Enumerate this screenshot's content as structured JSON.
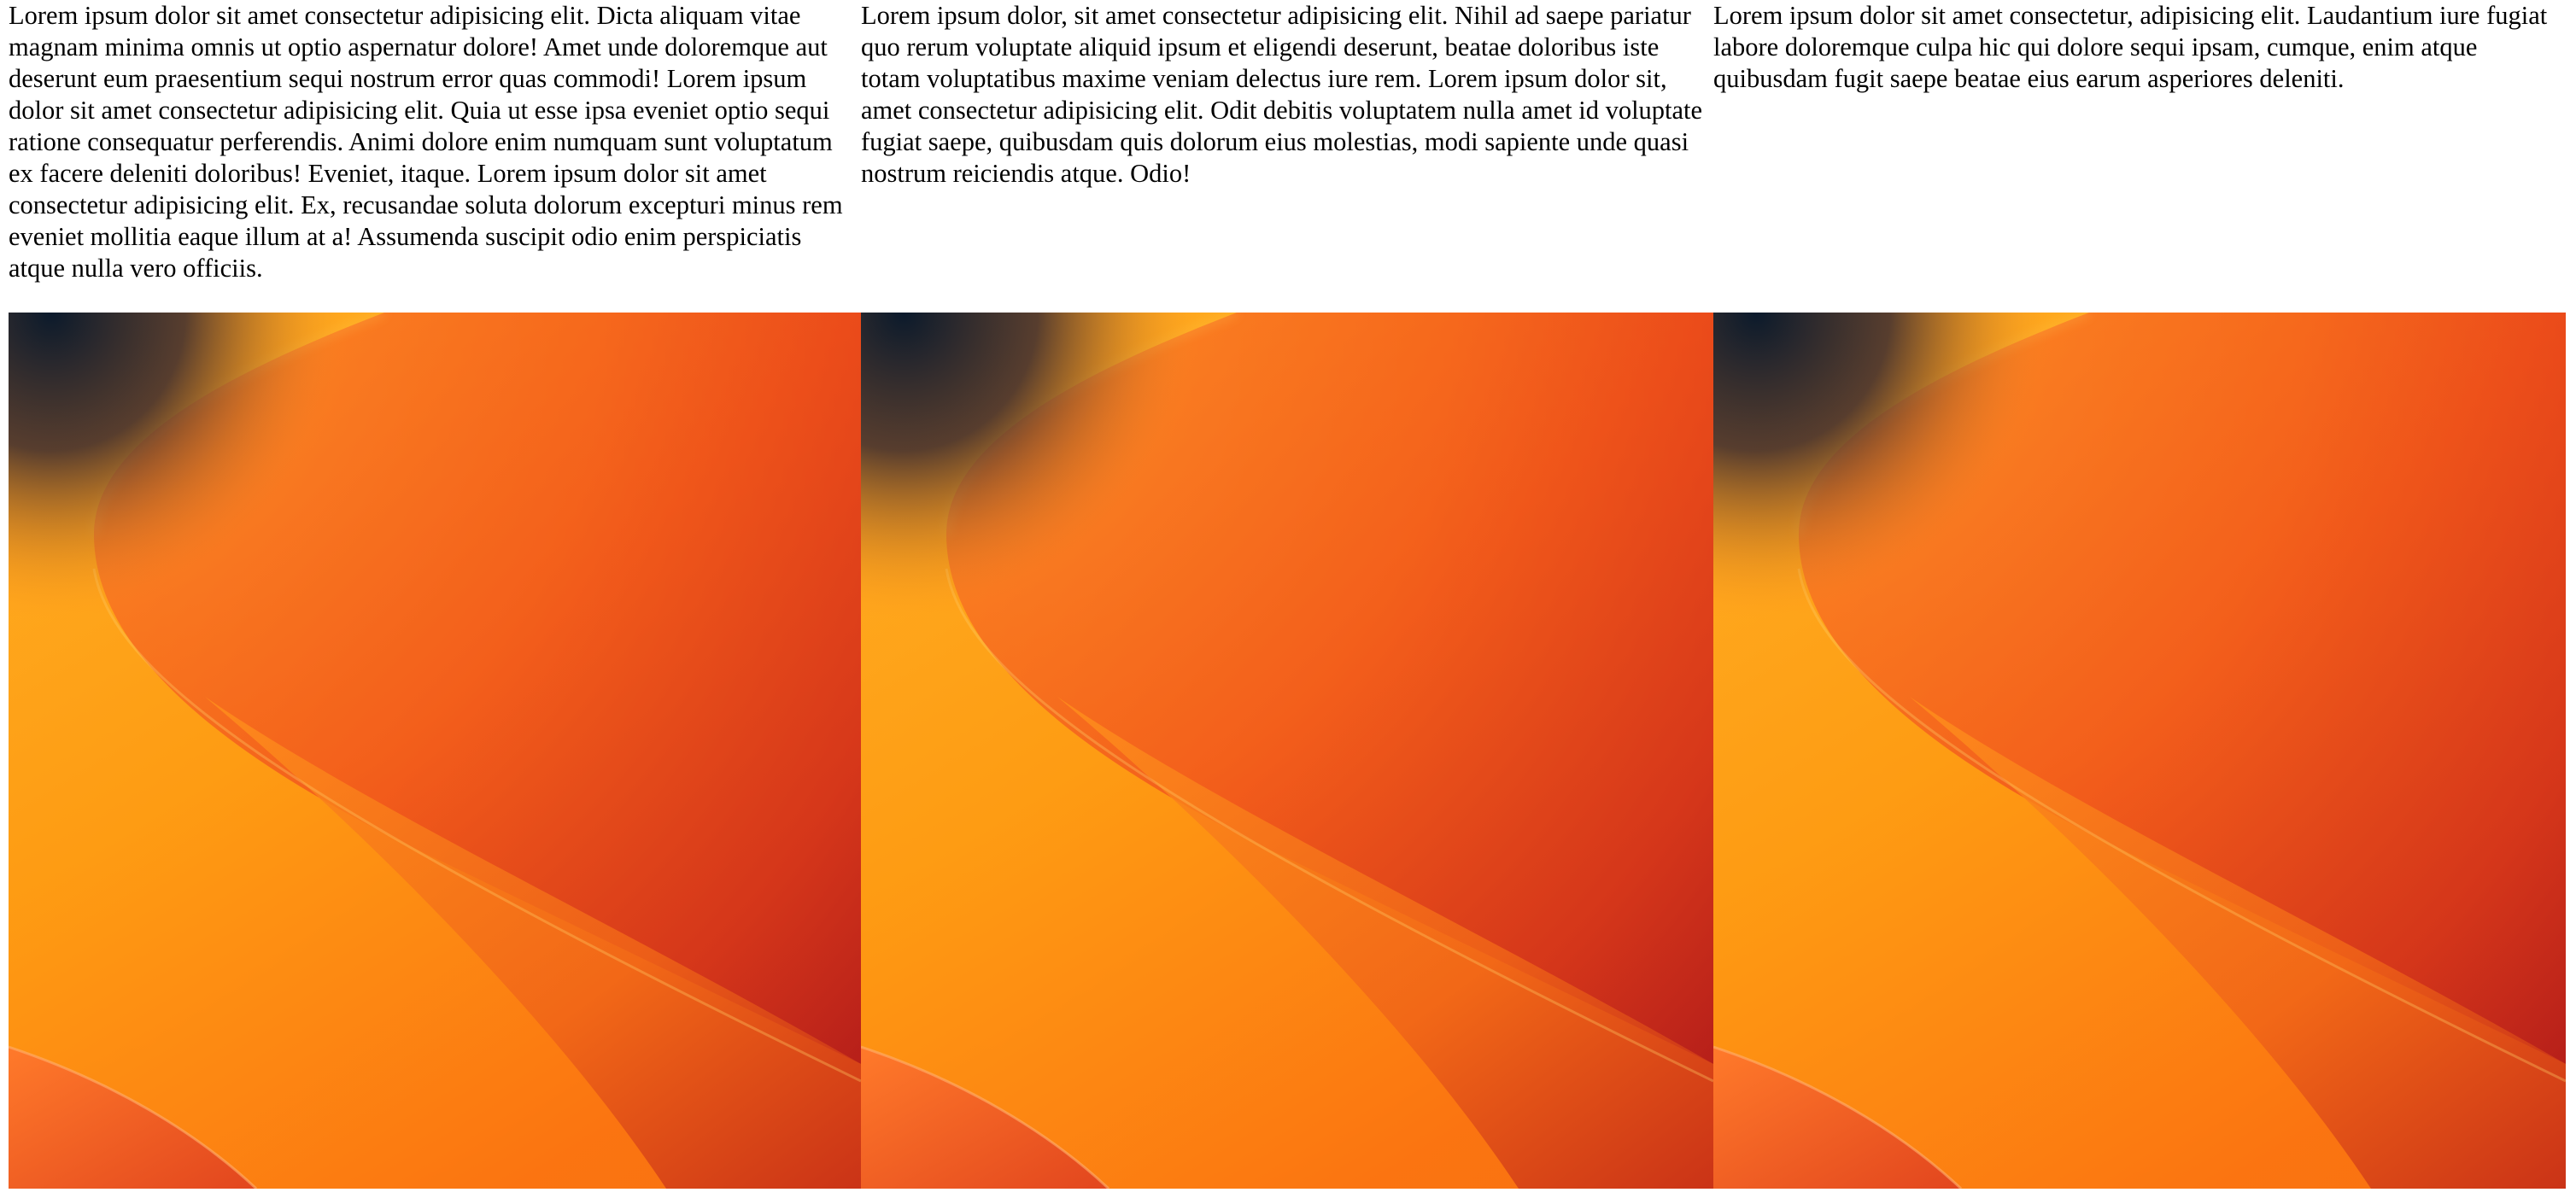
{
  "columns": [
    {
      "text": "Lorem ipsum dolor sit amet consectetur adipisicing elit. Dicta aliquam vitae magnam minima omnis ut optio aspernatur dolore! Amet unde doloremque aut deserunt eum praesentium sequi nostrum error quas commodi! Lorem ipsum dolor sit amet consectetur adipisicing elit. Quia ut esse ipsa eveniet optio sequi ratione consequatur perferendis. Animi dolore enim numquam sunt voluptatum ex facere deleniti doloribus! Eveniet, itaque. Lorem ipsum dolor sit amet consectetur adipisicing elit. Ex, recusandae soluta dolorum excepturi minus rem eveniet mollitia eaque illum at a! Assumenda suscipit odio enim perspiciatis atque nulla vero officiis."
    },
    {
      "text": "Lorem ipsum dolor, sit amet consectetur adipisicing elit. Nihil ad saepe pariatur quo rerum voluptate aliquid ipsum et eligendi deserunt, beatae doloribus iste totam voluptatibus maxime veniam delectus iure rem. Lorem ipsum dolor sit, amet consectetur adipisicing elit. Odit debitis voluptatem nulla amet id voluptate fugiat saepe, quibusdam quis dolorum eius molestias, modi sapiente unde quasi nostrum reiciendis atque. Odio!"
    },
    {
      "text": "Lorem ipsum dolor sit amet consectetur, adipisicing elit. Laudantium iure fugiat labore doloremque culpa hic qui dolore sequi ipsam, cumque, enim atque quibusdam fugit saepe beatae eius earum asperiores deleniti."
    }
  ],
  "wallpaper_colors": {
    "dark": "#0d1f33",
    "orange": "#ff8a1f",
    "yellow": "#ffb21a",
    "red": "#e0381a",
    "deep_red": "#a8181a"
  }
}
